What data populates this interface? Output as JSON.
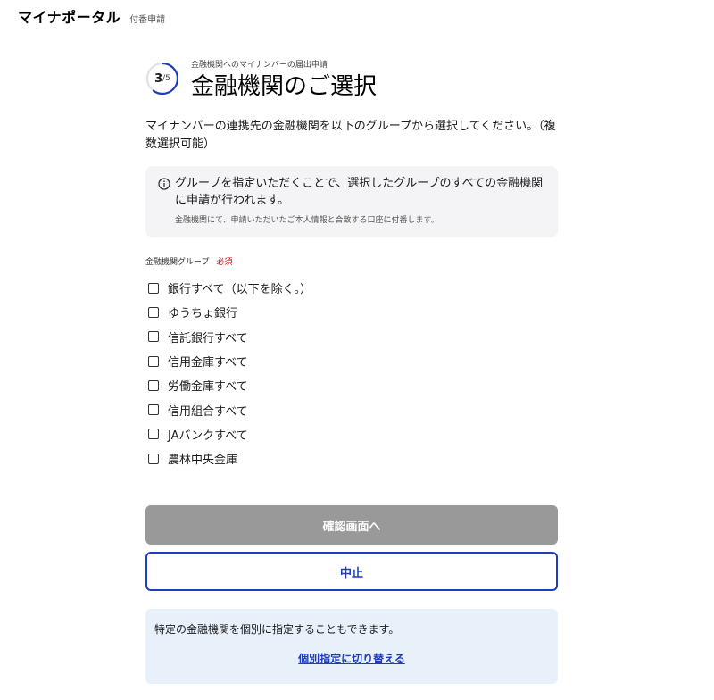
{
  "header": {
    "app_title": "マイナポータル",
    "app_subtitle": "付番申請"
  },
  "step": {
    "current": "3",
    "total": "/5",
    "progress_fraction": 0.6,
    "accent_color": "#1f3dbf"
  },
  "page": {
    "overline": "金融機関へのマイナンバーの届出申請",
    "title": "金融機関のご選択",
    "description": "マイナンバーの連携先の金融機関を以下のグループから選択してください。（複数選択可能）"
  },
  "notice": {
    "icon": "info-icon",
    "main_text": "グループを指定いただくことで、選択したグループのすべての金融機関に申請が行われます。",
    "sub_text": "金融機関にて、申請いただいたご本人情報と合致する口座に付番します。"
  },
  "group": {
    "label": "金融機関グループ",
    "required": "必須",
    "options": [
      {
        "label": "銀行すべて（以下を除く。）",
        "checked": false
      },
      {
        "label": "ゆうちょ銀行",
        "checked": false
      },
      {
        "label": "信託銀行すべて",
        "checked": false
      },
      {
        "label": "信用金庫すべて",
        "checked": false
      },
      {
        "label": "労働金庫すべて",
        "checked": false
      },
      {
        "label": "信用組合すべて",
        "checked": false
      },
      {
        "label": "JAバンクすべて",
        "checked": false
      },
      {
        "label": "農林中央金庫",
        "checked": false
      }
    ]
  },
  "buttons": {
    "confirm": "確認画面へ",
    "cancel": "中止"
  },
  "alternative": {
    "text": "特定の金融機関を個別に指定することもできます。",
    "link": "個別指定に切り替える"
  },
  "colors": {
    "confirm_disabled": "#999999",
    "accent": "#1f3dbf",
    "required": "#c00000",
    "notice_bg": "#f4f4f6",
    "alt_bg": "#e8f0fa"
  }
}
